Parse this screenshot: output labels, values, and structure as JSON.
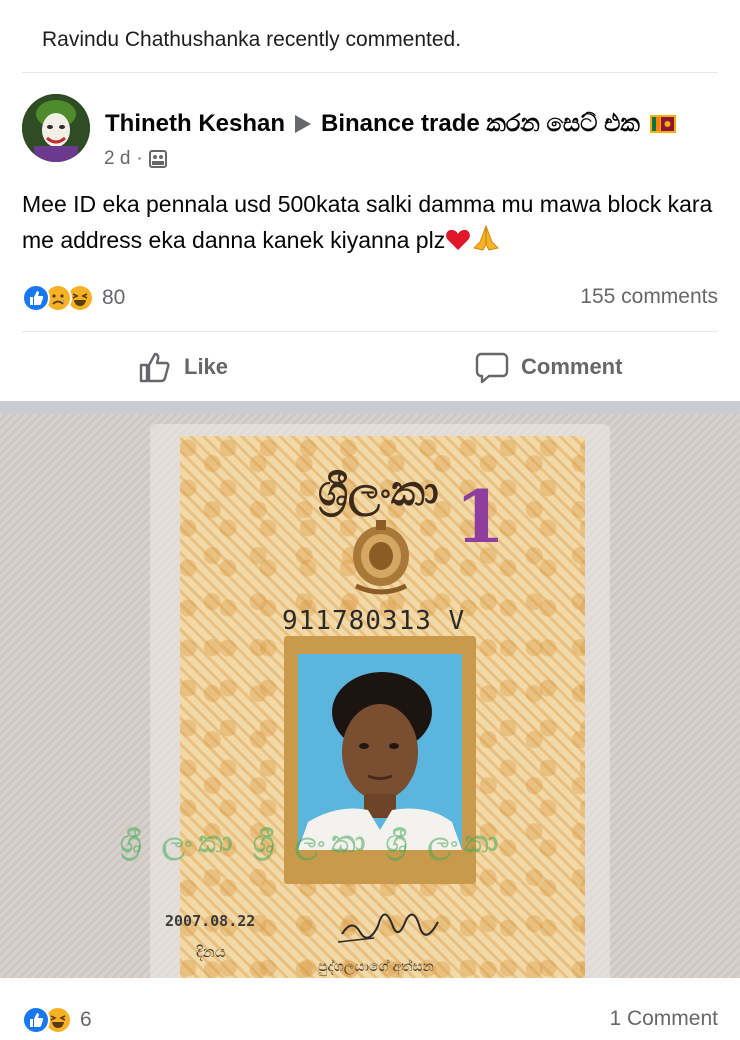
{
  "activity": {
    "text": "Ravindu Chathushanka recently commented."
  },
  "post": {
    "author": "Thineth Keshan",
    "group": "Binance trade කරන සෙට් එක",
    "time": "2 d",
    "separator": "·",
    "text": "Mee ID eka pennala usd 500kata salki damma mu mawa block kara me address eka danna kanek kiyanna plz",
    "text_emojis": [
      "red-heart",
      "folded-hands"
    ],
    "reactions": {
      "icons": [
        "like",
        "sad",
        "haha"
      ],
      "count": "80"
    },
    "comments_count": "155 comments"
  },
  "actions": {
    "like": "Like",
    "comment": "Comment"
  },
  "shared_photo": {
    "card_title": "ශ්‍රීලංකා",
    "card_number": "1",
    "id_number": "911780313 V",
    "watermark": "ශ්‍රී ලංකා ශ්‍රී ලංකා ශ්‍රී ලංකා",
    "issue_date": "2007.08.22",
    "date_label": "දිනය",
    "signature_label": "පුද්ගලයාගේ අත්සන"
  },
  "bottom_bar": {
    "reactions": {
      "icons": [
        "like",
        "haha"
      ],
      "count": "6"
    },
    "comments_count": "1 Comment"
  },
  "colors": {
    "like_blue": "#1877f2",
    "reaction_yellow": "#f7b125",
    "muted": "#65676b"
  }
}
